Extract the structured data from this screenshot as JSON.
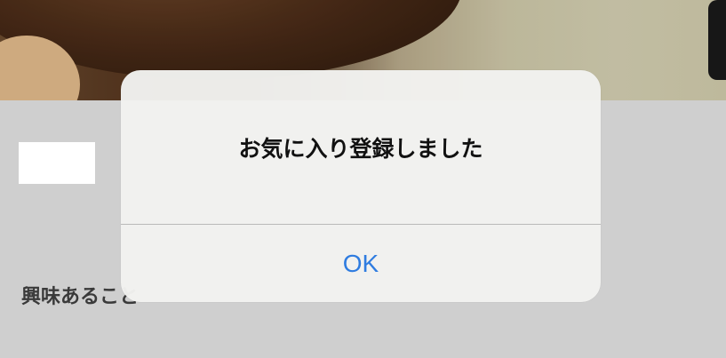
{
  "alert": {
    "message": "お気に入り登録しました",
    "ok_label": "OK"
  },
  "page": {
    "section_label": "興味あること"
  },
  "colors": {
    "ok_button": "#2f7ce0",
    "alert_background": "#f2f2f0",
    "dim_background": "#c9c9c9"
  }
}
